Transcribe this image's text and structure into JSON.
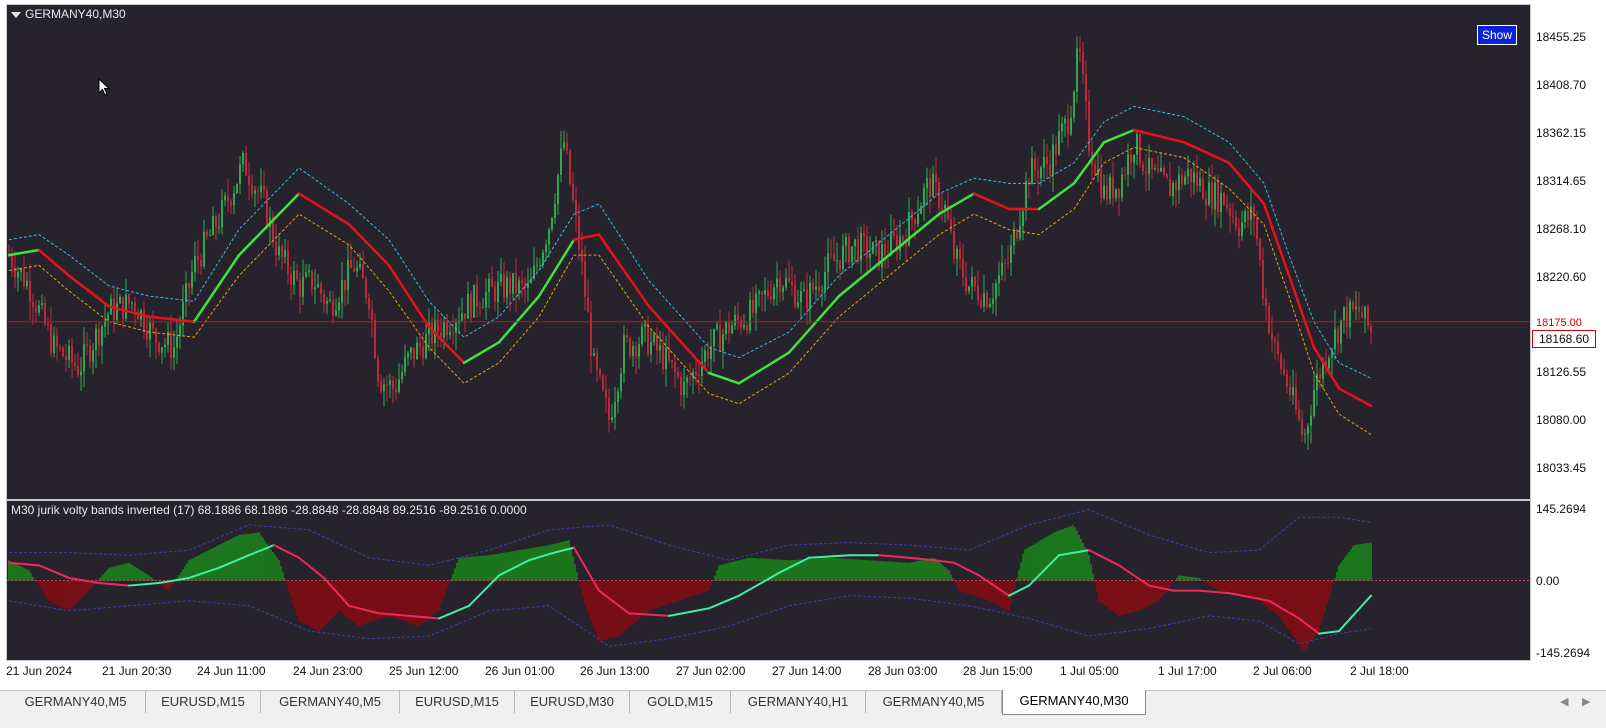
{
  "window": {
    "chart_title": "GERMANY40,M30",
    "show_button": "Show"
  },
  "indicator": {
    "label": "M30 jurik volty bands inverted (17) 68.1886 68.1886 -28.8848 -28.8848 89.2516 -89.2516 0.0000"
  },
  "price_axis": {
    "labels": [
      "18455.25",
      "18408.70",
      "18362.15",
      "18314.65",
      "18268.10",
      "18220.60",
      "18175.00",
      "18168.60",
      "18126.55",
      "18080.00",
      "18033.45"
    ],
    "current_price": "18168.60",
    "indicator_labels": [
      "145.2694",
      "0.00",
      "-145.2694"
    ]
  },
  "time_axis": {
    "labels": [
      "21 Jun 2024",
      "21 Jun 20:30",
      "24 Jun 11:00",
      "24 Jun 23:00",
      "25 Jun 12:00",
      "26 Jun 01:00",
      "26 Jun 13:00",
      "27 Jun 02:00",
      "27 Jun 14:00",
      "28 Jun 03:00",
      "28 Jun 15:00",
      "1 Jul 05:00",
      "1 Jul 17:00",
      "2 Jul 06:00",
      "2 Jul 18:00"
    ]
  },
  "tabs": [
    {
      "label": "GERMANY40,M5",
      "active": false
    },
    {
      "label": "EURUSD,M15",
      "active": false
    },
    {
      "label": "GERMANY40,M5",
      "active": false
    },
    {
      "label": "EURUSD,M15",
      "active": false
    },
    {
      "label": "EURUSD,M30",
      "active": false
    },
    {
      "label": "GOLD,M15",
      "active": false
    },
    {
      "label": "GERMANY40,H1",
      "active": false
    },
    {
      "label": "GERMANY40,M5",
      "active": false
    },
    {
      "label": "GERMANY40,M30",
      "active": true
    }
  ],
  "colors": {
    "background": "#26232c",
    "bull_candle": "#2fa84f",
    "bear_candle": "#c0283a",
    "jma_up": "#3ee33e",
    "jma_down": "#e8121a",
    "band_upper": "#3fb6e8",
    "band_lower": "#e8a412",
    "hist_pos": "#1a8a1a",
    "hist_neg": "#8c0a10",
    "price_line": "#d01010"
  },
  "chart_data": {
    "type": "candlestick",
    "symbol": "GERMANY40",
    "timeframe": "M30",
    "ylim": [
      18010,
      18480
    ],
    "close_path": [
      [
        0,
        18240
      ],
      [
        20,
        18210
      ],
      [
        45,
        18150
      ],
      [
        70,
        18130
      ],
      [
        100,
        18185
      ],
      [
        125,
        18195
      ],
      [
        145,
        18160
      ],
      [
        165,
        18150
      ],
      [
        185,
        18230
      ],
      [
        210,
        18275
      ],
      [
        235,
        18330
      ],
      [
        255,
        18290
      ],
      [
        270,
        18240
      ],
      [
        290,
        18210
      ],
      [
        305,
        18215
      ],
      [
        320,
        18190
      ],
      [
        345,
        18230
      ],
      [
        360,
        18200
      ],
      [
        370,
        18120
      ],
      [
        385,
        18110
      ],
      [
        400,
        18140
      ],
      [
        420,
        18160
      ],
      [
        445,
        18180
      ],
      [
        470,
        18200
      ],
      [
        500,
        18210
      ],
      [
        520,
        18205
      ],
      [
        540,
        18270
      ],
      [
        555,
        18350
      ],
      [
        570,
        18250
      ],
      [
        585,
        18130
      ],
      [
        600,
        18080
      ],
      [
        615,
        18150
      ],
      [
        635,
        18160
      ],
      [
        655,
        18140
      ],
      [
        675,
        18110
      ],
      [
        700,
        18150
      ],
      [
        720,
        18170
      ],
      [
        745,
        18185
      ],
      [
        770,
        18220
      ],
      [
        795,
        18195
      ],
      [
        820,
        18230
      ],
      [
        845,
        18250
      ],
      [
        870,
        18240
      ],
      [
        895,
        18260
      ],
      [
        920,
        18310
      ],
      [
        935,
        18290
      ],
      [
        945,
        18240
      ],
      [
        960,
        18210
      ],
      [
        980,
        18200
      ],
      [
        1000,
        18235
      ],
      [
        1020,
        18320
      ],
      [
        1040,
        18330
      ],
      [
        1060,
        18375
      ],
      [
        1070,
        18440
      ],
      [
        1080,
        18350
      ],
      [
        1095,
        18300
      ],
      [
        1110,
        18310
      ],
      [
        1125,
        18350
      ],
      [
        1140,
        18320
      ],
      [
        1160,
        18305
      ],
      [
        1180,
        18320
      ],
      [
        1200,
        18300
      ],
      [
        1215,
        18295
      ],
      [
        1230,
        18270
      ],
      [
        1245,
        18280
      ],
      [
        1255,
        18200
      ],
      [
        1265,
        18150
      ],
      [
        1280,
        18110
      ],
      [
        1295,
        18060
      ],
      [
        1305,
        18110
      ],
      [
        1320,
        18150
      ],
      [
        1335,
        18180
      ],
      [
        1350,
        18185
      ],
      [
        1362,
        18165
      ]
    ],
    "jma": [
      [
        0,
        18240
      ],
      [
        30,
        18245
      ],
      [
        60,
        18220
      ],
      [
        100,
        18190
      ],
      [
        140,
        18180
      ],
      [
        185,
        18175
      ],
      [
        230,
        18240
      ],
      [
        290,
        18300
      ],
      [
        340,
        18270
      ],
      [
        380,
        18230
      ],
      [
        420,
        18170
      ],
      [
        455,
        18135
      ],
      [
        490,
        18155
      ],
      [
        530,
        18200
      ],
      [
        565,
        18255
      ],
      [
        590,
        18260
      ],
      [
        640,
        18190
      ],
      [
        700,
        18125
      ],
      [
        730,
        18115
      ],
      [
        780,
        18145
      ],
      [
        830,
        18200
      ],
      [
        880,
        18240
      ],
      [
        930,
        18280
      ],
      [
        965,
        18300
      ],
      [
        1000,
        18285
      ],
      [
        1030,
        18285
      ],
      [
        1065,
        18310
      ],
      [
        1095,
        18350
      ],
      [
        1125,
        18362
      ],
      [
        1175,
        18350
      ],
      [
        1220,
        18330
      ],
      [
        1255,
        18290
      ],
      [
        1280,
        18220
      ],
      [
        1305,
        18150
      ],
      [
        1330,
        18110
      ],
      [
        1362,
        18093
      ]
    ],
    "jma_colors": [
      "up",
      "up",
      "down",
      "down",
      "down",
      "down",
      "up",
      "up",
      "down",
      "down",
      "down",
      "down",
      "up",
      "up",
      "up",
      "down",
      "down",
      "down",
      "up",
      "up",
      "up",
      "up",
      "up",
      "up",
      "down",
      "down",
      "up",
      "up",
      "up",
      "down",
      "down",
      "down",
      "down",
      "down",
      "down",
      "down"
    ],
    "band_upper": [
      [
        0,
        18255
      ],
      [
        30,
        18260
      ],
      [
        60,
        18240
      ],
      [
        100,
        18210
      ],
      [
        140,
        18200
      ],
      [
        185,
        18195
      ],
      [
        230,
        18265
      ],
      [
        290,
        18325
      ],
      [
        340,
        18290
      ],
      [
        380,
        18255
      ],
      [
        420,
        18195
      ],
      [
        455,
        18160
      ],
      [
        490,
        18180
      ],
      [
        530,
        18225
      ],
      [
        565,
        18280
      ],
      [
        590,
        18290
      ],
      [
        640,
        18215
      ],
      [
        700,
        18150
      ],
      [
        730,
        18140
      ],
      [
        780,
        18165
      ],
      [
        830,
        18220
      ],
      [
        880,
        18260
      ],
      [
        930,
        18300
      ],
      [
        965,
        18315
      ],
      [
        1000,
        18310
      ],
      [
        1030,
        18310
      ],
      [
        1065,
        18330
      ],
      [
        1095,
        18370
      ],
      [
        1125,
        18385
      ],
      [
        1175,
        18375
      ],
      [
        1220,
        18350
      ],
      [
        1255,
        18310
      ],
      [
        1280,
        18240
      ],
      [
        1305,
        18175
      ],
      [
        1330,
        18135
      ],
      [
        1362,
        18120
      ]
    ],
    "band_lower": [
      [
        0,
        18225
      ],
      [
        30,
        18230
      ],
      [
        60,
        18205
      ],
      [
        100,
        18175
      ],
      [
        140,
        18165
      ],
      [
        185,
        18160
      ],
      [
        230,
        18220
      ],
      [
        290,
        18280
      ],
      [
        340,
        18250
      ],
      [
        380,
        18205
      ],
      [
        420,
        18150
      ],
      [
        455,
        18115
      ],
      [
        490,
        18135
      ],
      [
        530,
        18180
      ],
      [
        565,
        18240
      ],
      [
        590,
        18240
      ],
      [
        640,
        18170
      ],
      [
        700,
        18105
      ],
      [
        730,
        18095
      ],
      [
        780,
        18125
      ],
      [
        830,
        18180
      ],
      [
        880,
        18220
      ],
      [
        930,
        18260
      ],
      [
        965,
        18280
      ],
      [
        1000,
        18265
      ],
      [
        1030,
        18260
      ],
      [
        1065,
        18285
      ],
      [
        1095,
        18330
      ],
      [
        1125,
        18345
      ],
      [
        1175,
        18335
      ],
      [
        1220,
        18305
      ],
      [
        1255,
        18270
      ],
      [
        1280,
        18200
      ],
      [
        1305,
        18125
      ],
      [
        1330,
        18085
      ],
      [
        1362,
        18065
      ]
    ],
    "current_price_line": 18175.0,
    "indicator": {
      "name": "M30 jurik volty bands inverted (17)",
      "ylim": [
        -145.2694,
        145.2694
      ],
      "histogram": [
        [
          0,
          40
        ],
        [
          20,
          20
        ],
        [
          40,
          -40
        ],
        [
          60,
          -60
        ],
        [
          80,
          -20
        ],
        [
          100,
          25
        ],
        [
          120,
          35
        ],
        [
          140,
          10
        ],
        [
          160,
          -20
        ],
        [
          180,
          40
        ],
        [
          200,
          60
        ],
        [
          230,
          90
        ],
        [
          250,
          95
        ],
        [
          270,
          40
        ],
        [
          290,
          -80
        ],
        [
          310,
          -100
        ],
        [
          330,
          -60
        ],
        [
          350,
          -90
        ],
        [
          380,
          -70
        ],
        [
          410,
          -90
        ],
        [
          430,
          -60
        ],
        [
          450,
          45
        ],
        [
          480,
          50
        ],
        [
          510,
          60
        ],
        [
          540,
          70
        ],
        [
          560,
          80
        ],
        [
          575,
          -40
        ],
        [
          590,
          -120
        ],
        [
          610,
          -110
        ],
        [
          640,
          -60
        ],
        [
          670,
          -40
        ],
        [
          700,
          -20
        ],
        [
          710,
          30
        ],
        [
          740,
          45
        ],
        [
          780,
          40
        ],
        [
          820,
          45
        ],
        [
          860,
          40
        ],
        [
          900,
          35
        ],
        [
          925,
          45
        ],
        [
          940,
          20
        ],
        [
          950,
          -20
        ],
        [
          980,
          -40
        ],
        [
          1000,
          -60
        ],
        [
          1015,
          60
        ],
        [
          1045,
          95
        ],
        [
          1065,
          110
        ],
        [
          1080,
          50
        ],
        [
          1090,
          -40
        ],
        [
          1110,
          -70
        ],
        [
          1130,
          -60
        ],
        [
          1150,
          -40
        ],
        [
          1170,
          10
        ],
        [
          1190,
          5
        ],
        [
          1210,
          -20
        ],
        [
          1250,
          -40
        ],
        [
          1270,
          -70
        ],
        [
          1295,
          -140
        ],
        [
          1310,
          -100
        ],
        [
          1330,
          30
        ],
        [
          1345,
          70
        ],
        [
          1362,
          75
        ]
      ],
      "fast_line": [
        [
          0,
          35
        ],
        [
          30,
          30
        ],
        [
          60,
          5
        ],
        [
          90,
          -5
        ],
        [
          120,
          -10
        ],
        [
          150,
          -5
        ],
        [
          180,
          5
        ],
        [
          210,
          25
        ],
        [
          240,
          50
        ],
        [
          265,
          70
        ],
        [
          290,
          45
        ],
        [
          315,
          5
        ],
        [
          340,
          -50
        ],
        [
          370,
          -65
        ],
        [
          400,
          -70
        ],
        [
          430,
          -75
        ],
        [
          460,
          -50
        ],
        [
          490,
          10
        ],
        [
          520,
          40
        ],
        [
          545,
          55
        ],
        [
          565,
          65
        ],
        [
          590,
          -20
        ],
        [
          620,
          -65
        ],
        [
          660,
          -70
        ],
        [
          700,
          -55
        ],
        [
          730,
          -30
        ],
        [
          770,
          15
        ],
        [
          800,
          45
        ],
        [
          840,
          50
        ],
        [
          870,
          50
        ],
        [
          900,
          45
        ],
        [
          925,
          40
        ],
        [
          945,
          35
        ],
        [
          970,
          10
        ],
        [
          1000,
          -30
        ],
        [
          1020,
          -10
        ],
        [
          1050,
          50
        ],
        [
          1080,
          60
        ],
        [
          1110,
          30
        ],
        [
          1140,
          -10
        ],
        [
          1165,
          -20
        ],
        [
          1190,
          -20
        ],
        [
          1220,
          -25
        ],
        [
          1260,
          -40
        ],
        [
          1290,
          -75
        ],
        [
          1310,
          -105
        ],
        [
          1330,
          -100
        ],
        [
          1362,
          -30
        ]
      ],
      "fast_line_colors": [
        "up",
        "down",
        "down",
        "down",
        "down",
        "up",
        "up",
        "up",
        "up",
        "up",
        "down",
        "down",
        "down",
        "down",
        "down",
        "down",
        "up",
        "up",
        "up",
        "up",
        "up",
        "down",
        "down",
        "down",
        "up",
        "up",
        "up",
        "up",
        "up",
        "up",
        "down",
        "down",
        "down",
        "down",
        "down",
        "up",
        "up",
        "up",
        "down",
        "down",
        "down",
        "down",
        "down",
        "down",
        "down",
        "down",
        "up",
        "up"
      ],
      "band_upper": [
        [
          0,
          55
        ],
        [
          60,
          55
        ],
        [
          120,
          50
        ],
        [
          180,
          60
        ],
        [
          240,
          110
        ],
        [
          300,
          100
        ],
        [
          360,
          45
        ],
        [
          420,
          30
        ],
        [
          480,
          60
        ],
        [
          540,
          100
        ],
        [
          600,
          110
        ],
        [
          660,
          70
        ],
        [
          720,
          40
        ],
        [
          780,
          70
        ],
        [
          840,
          75
        ],
        [
          900,
          70
        ],
        [
          960,
          60
        ],
        [
          1020,
          110
        ],
        [
          1080,
          140
        ],
        [
          1140,
          90
        ],
        [
          1200,
          55
        ],
        [
          1250,
          60
        ],
        [
          1290,
          125
        ],
        [
          1330,
          125
        ],
        [
          1362,
          115
        ]
      ],
      "band_lower": [
        [
          0,
          -40
        ],
        [
          60,
          -60
        ],
        [
          120,
          -50
        ],
        [
          180,
          -40
        ],
        [
          240,
          -50
        ],
        [
          300,
          -100
        ],
        [
          360,
          -115
        ],
        [
          420,
          -110
        ],
        [
          480,
          -60
        ],
        [
          540,
          -50
        ],
        [
          600,
          -130
        ],
        [
          660,
          -115
        ],
        [
          720,
          -90
        ],
        [
          780,
          -50
        ],
        [
          840,
          -30
        ],
        [
          900,
          -35
        ],
        [
          960,
          -50
        ],
        [
          1020,
          -75
        ],
        [
          1080,
          -110
        ],
        [
          1140,
          -95
        ],
        [
          1200,
          -70
        ],
        [
          1250,
          -80
        ],
        [
          1290,
          -125
        ],
        [
          1330,
          -105
        ],
        [
          1362,
          -95
        ]
      ]
    }
  }
}
